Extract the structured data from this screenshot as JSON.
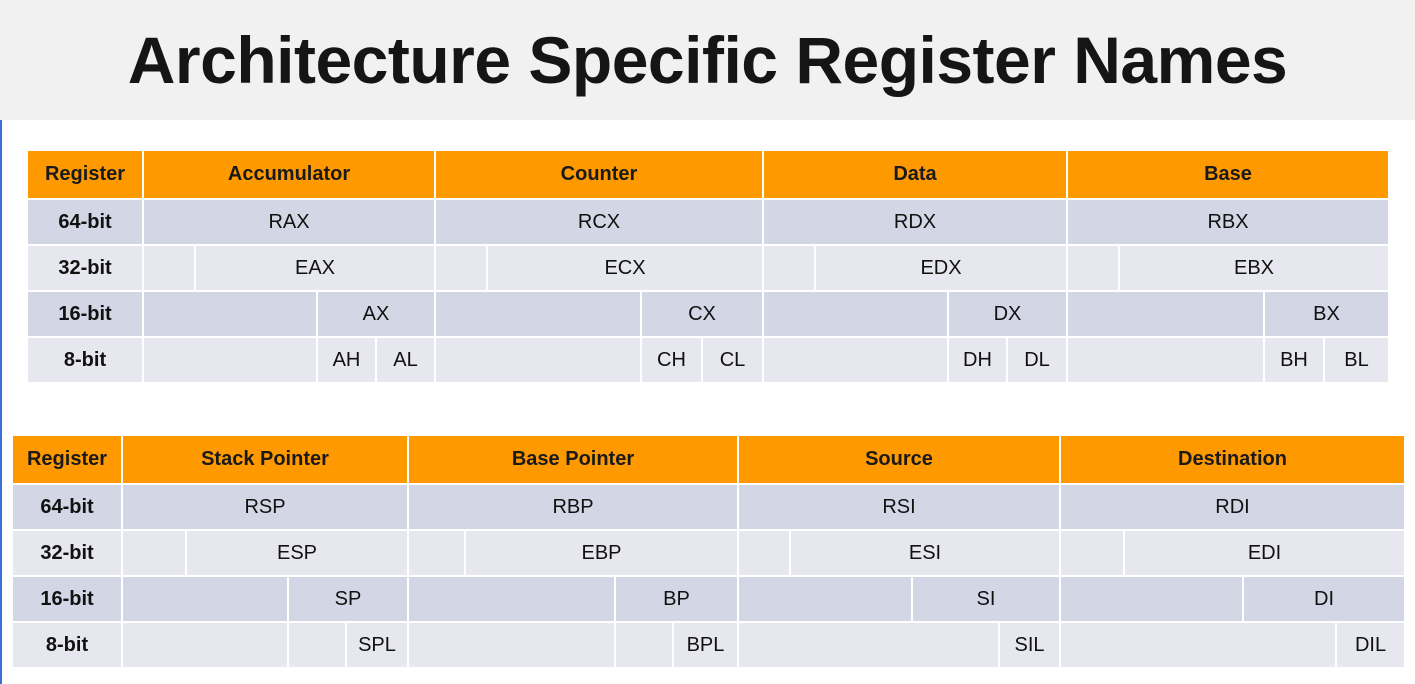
{
  "title": "Architecture Specific Register Names",
  "colors": {
    "header_orange": "#ff9900",
    "row_dark": "#d3d6e4",
    "row_light": "#e6e7ef",
    "title_bg": "#f1f1f1"
  },
  "tables": [
    {
      "head_label": "Register",
      "sections": [
        "Accumulator",
        "Counter",
        "Data",
        "Base"
      ],
      "rows": [
        {
          "label": "64-bit",
          "values": [
            "RAX",
            "RCX",
            "RDX",
            "RBX"
          ]
        },
        {
          "label": "32-bit",
          "values": [
            "EAX",
            "ECX",
            "EDX",
            "EBX"
          ]
        },
        {
          "label": "16-bit",
          "values": [
            "AX",
            "CX",
            "DX",
            "BX"
          ]
        },
        {
          "label": "8-bit",
          "values": [
            [
              "AH",
              "AL"
            ],
            [
              "CH",
              "CL"
            ],
            [
              "DH",
              "DL"
            ],
            [
              "BH",
              "BL"
            ]
          ]
        }
      ]
    },
    {
      "head_label": "Register",
      "sections": [
        "Stack Pointer",
        "Base Pointer",
        "Source",
        "Destination"
      ],
      "rows": [
        {
          "label": "64-bit",
          "values": [
            "RSP",
            "RBP",
            "RSI",
            "RDI"
          ]
        },
        {
          "label": "32-bit",
          "values": [
            "ESP",
            "EBP",
            "ESI",
            "EDI"
          ]
        },
        {
          "label": "16-bit",
          "values": [
            "SP",
            "BP",
            "SI",
            "DI"
          ]
        },
        {
          "label": "8-bit",
          "values": [
            "SPL",
            "BPL",
            "SIL",
            "DIL"
          ]
        }
      ]
    }
  ]
}
